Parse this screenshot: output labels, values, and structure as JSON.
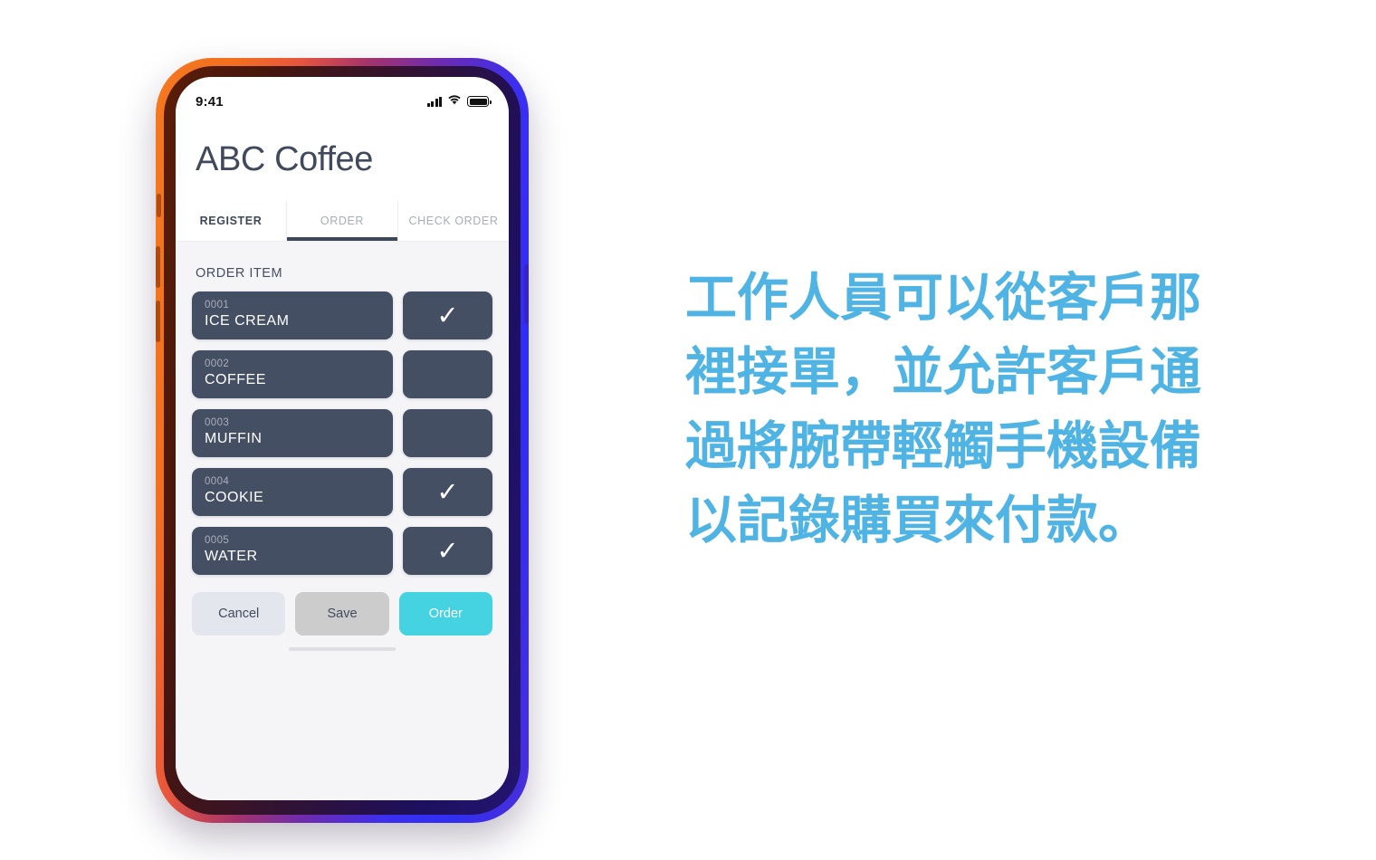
{
  "device": {
    "status_bar": {
      "time": "9:41",
      "signal_icon": "cellular-signal-icon",
      "wifi_icon": "wifi-icon",
      "battery_icon": "battery-full-icon"
    }
  },
  "app": {
    "title": "ABC Coffee",
    "tabs": [
      {
        "label": "REGISTER",
        "active": false,
        "dark": true
      },
      {
        "label": "ORDER",
        "active": true,
        "dark": false
      },
      {
        "label": "CHECK ORDER",
        "active": false,
        "dark": false
      }
    ],
    "section_label": "ORDER ITEM",
    "items": [
      {
        "code": "0001",
        "name": "ICE CREAM",
        "checked": true
      },
      {
        "code": "0002",
        "name": "COFFEE",
        "checked": false
      },
      {
        "code": "0003",
        "name": "MUFFIN",
        "checked": false
      },
      {
        "code": "0004",
        "name": "COOKIE",
        "checked": true
      },
      {
        "code": "0005",
        "name": "WATER",
        "checked": true
      }
    ],
    "check_glyph": "✓",
    "actions": {
      "cancel": "Cancel",
      "save": "Save",
      "order": "Order"
    }
  },
  "caption": {
    "text": "工作人員可以從客戶那裡接單，並允許客戶通過將腕帶輕觸手機設備以記錄購買來付款。"
  },
  "colors": {
    "accent_cyan": "#45d3e2",
    "caption_blue": "#4fb4e3",
    "card_slate": "#454f63",
    "content_bg": "#f5f5f8"
  }
}
